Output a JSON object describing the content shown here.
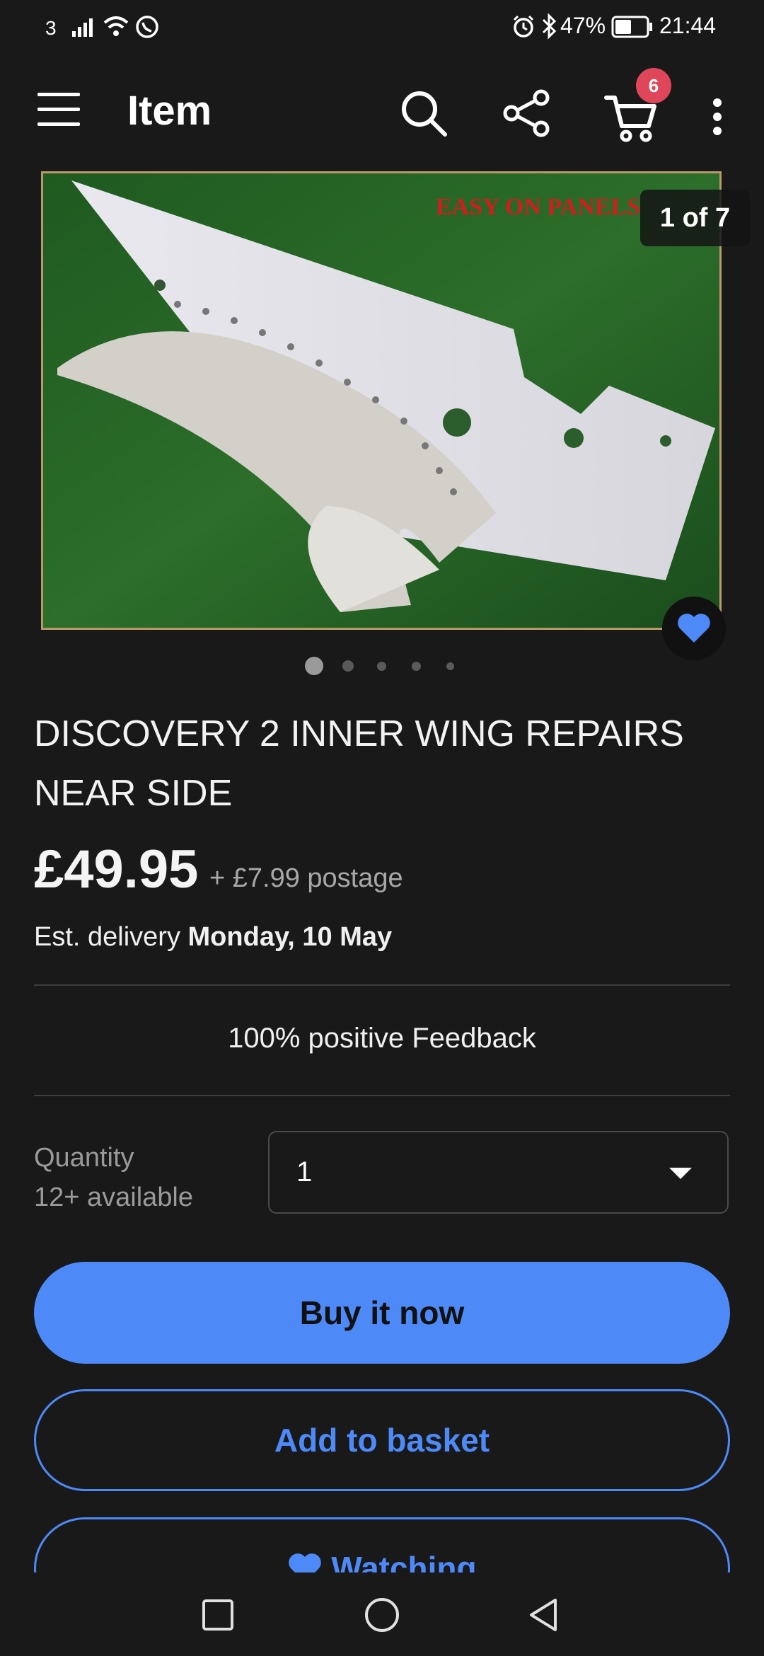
{
  "status_bar": {
    "network": "3",
    "battery": "47%",
    "time": "21:44"
  },
  "app_bar": {
    "title": "Item",
    "cart_count": "6",
    "icons": [
      "menu-icon",
      "search-icon",
      "share-icon",
      "cart-icon",
      "more-vert-icon"
    ]
  },
  "gallery": {
    "counter": "1 of 7",
    "watermark": "EASY ON PANELS",
    "dots_total": 5,
    "active_dot": 0
  },
  "item": {
    "title": "DISCOVERY 2 INNER WING REPAIRS NEAR SIDE",
    "price": "£49.95",
    "postage": "+ £7.99 postage",
    "delivery_prefix": "Est. delivery",
    "delivery_date": "Monday, 10 May",
    "feedback": "100% positive Feedback"
  },
  "quantity": {
    "label": "Quantity",
    "available": "12+ available",
    "value": "1"
  },
  "actions": {
    "buy_now": "Buy it now",
    "add_to_basket": "Add to basket",
    "watching": "Watching"
  },
  "colors": {
    "background": "#191919",
    "accent": "#4d8af8",
    "badge": "#e0465a"
  }
}
